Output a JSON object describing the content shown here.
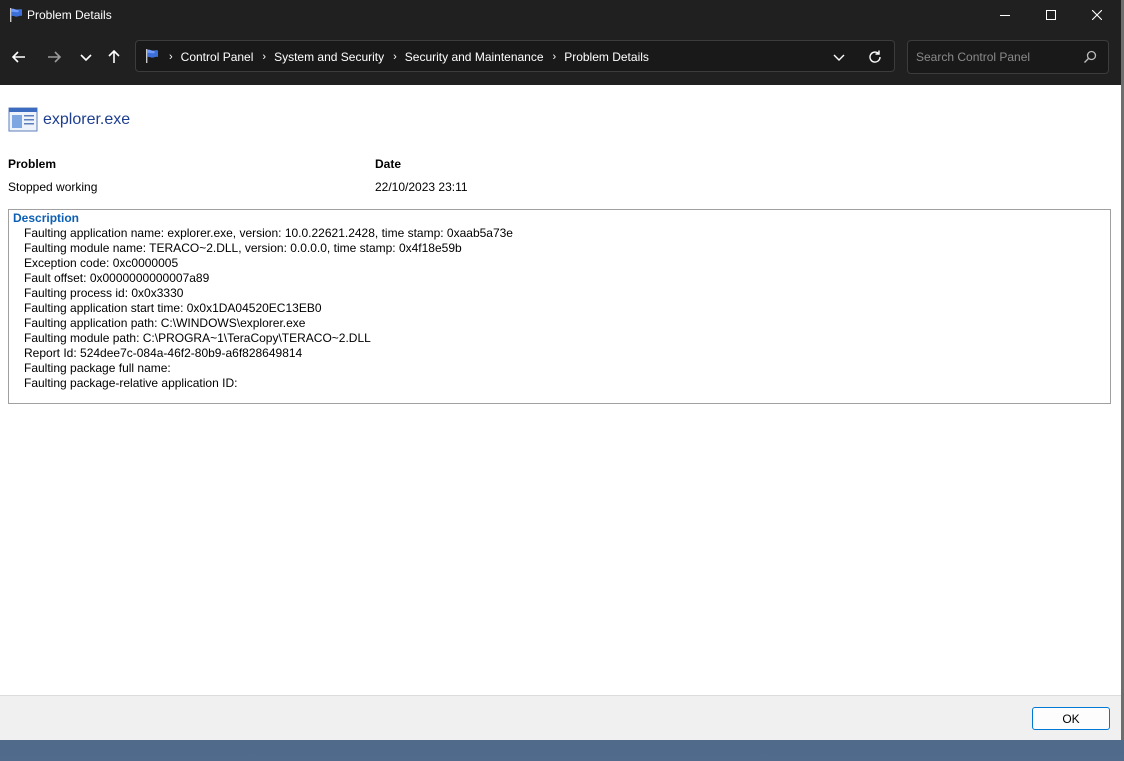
{
  "window": {
    "title": "Problem Details"
  },
  "nav": {
    "breadcrumb": [
      "Control Panel",
      "System and Security",
      "Security and Maintenance",
      "Problem Details"
    ],
    "separator": "›"
  },
  "search": {
    "placeholder": "Search Control Panel"
  },
  "app": {
    "name": "explorer.exe"
  },
  "problem": {
    "problem_label": "Problem",
    "problem_value": "Stopped working",
    "date_label": "Date",
    "date_value": "22/10/2023 23:11"
  },
  "description": {
    "title": "Description",
    "lines": [
      "Faulting application name: explorer.exe, version: 10.0.22621.2428, time stamp: 0xaab5a73e",
      "Faulting module name: TERACO~2.DLL, version: 0.0.0.0, time stamp: 0x4f18e59b",
      "Exception code: 0xc0000005",
      "Fault offset: 0x0000000000007a89",
      "Faulting process id: 0x0x3330",
      "Faulting application start time: 0x0x1DA04520EC13EB0",
      "Faulting application path: C:\\WINDOWS\\explorer.exe",
      "Faulting module path: C:\\PROGRA~1\\TeraCopy\\TERACO~2.DLL",
      "Report Id: 524dee7c-084a-46f2-80b9-a6f828649814",
      "Faulting package full name:",
      "Faulting package-relative application ID:"
    ]
  },
  "footer": {
    "ok_label": "OK"
  },
  "colors": {
    "titlebar": "#202020",
    "link_blue": "#1e3e8f",
    "description_blue": "#0b5fb4",
    "accent": "#0078d4"
  }
}
